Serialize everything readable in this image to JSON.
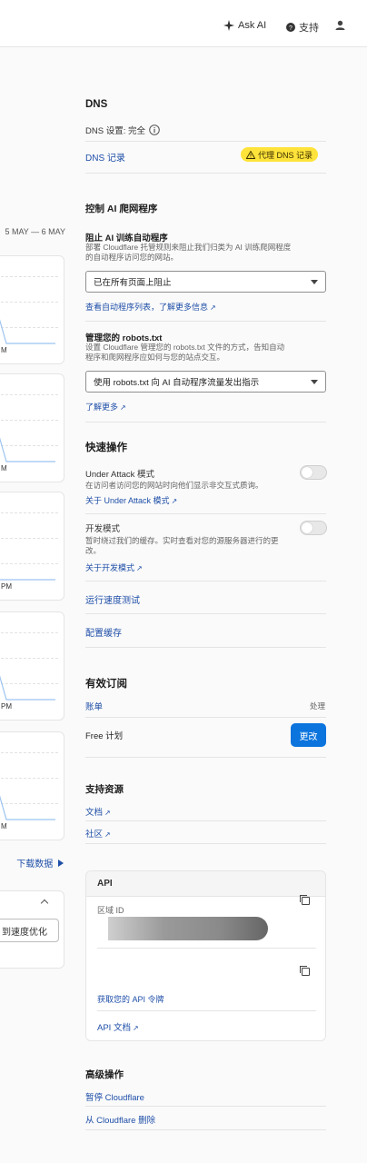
{
  "topbar": {
    "ask_ai": "Ask AI",
    "support": "支持"
  },
  "left": {
    "date_range": "5 MAY — 6 MAY",
    "card_label": "M",
    "card_label_pm": "PM",
    "download": "下载数据",
    "optimize_button": "到速度优化"
  },
  "dns": {
    "title": "DNS",
    "setting_label": "DNS 设置: 完全",
    "records_link": "DNS 记录",
    "proxy_badge": "代理 DNS 记录"
  },
  "ai_crawlers": {
    "title": "控制 AI 爬网程序",
    "block_title": "阻止 AI 训练自动程序",
    "block_desc_1": "部署 Cloudflare 托管规则来阻止我们归类为 AI 训练爬网程度",
    "block_desc_2": "的自动程序访问您的网站。",
    "block_select": "已在所有页面上阻止",
    "block_link": "查看自动程序列表，了解更多信息",
    "robots_title": "管理您的 robots.txt",
    "robots_desc_1": "设置 Cloudflare 管理您的 robots.txt 文件的方式，告知自动",
    "robots_desc_2": "程序和爬网程序应如何与您的站点交互。",
    "robots_select": "使用 robots.txt 向 AI 自动程序流量发出指示",
    "robots_link": "了解更多"
  },
  "quick_actions": {
    "title": "快速操作",
    "under_attack_title": "Under Attack 模式",
    "under_attack_desc": "在访问者访问您的网站时向他们显示非交互式质询。",
    "under_attack_link": "关于 Under Attack 模式",
    "dev_title": "开发模式",
    "dev_desc_1": "暂时绕过我们的缓存。实时查看对您的源服务器进行的更",
    "dev_desc_2": "改。",
    "dev_link": "关于开发模式",
    "speed_test": "运行速度测试",
    "config_cache": "配置缓存"
  },
  "subscription": {
    "title": "有效订阅",
    "billing": "账单",
    "handle": "处理",
    "plan": "Free 计划",
    "change_button": "更改"
  },
  "resources": {
    "title": "支持资源",
    "docs": "文档",
    "community": "社区"
  },
  "api": {
    "title": "API",
    "zone_id_label": "区域 ID",
    "get_token_link": "获取您的 API 令牌",
    "api_docs_link": "API 文档"
  },
  "advanced": {
    "title": "高级操作",
    "pause": "暂停 Cloudflare",
    "remove": "从 Cloudflare 删除"
  },
  "colors": {
    "link": "#1f4fa8",
    "primary": "#0b74dd",
    "warning": "#ffe33a"
  }
}
